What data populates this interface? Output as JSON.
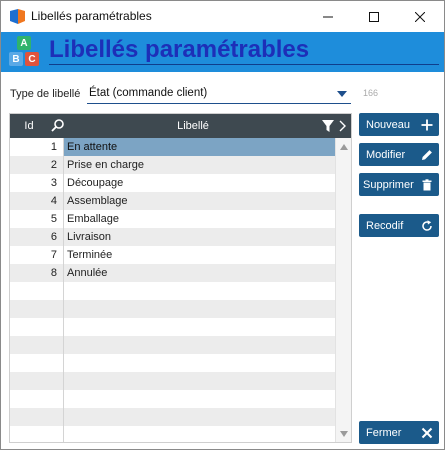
{
  "window": {
    "title": "Libellés paramétrables"
  },
  "banner": {
    "title": "Libellés paramétrables",
    "logo_letters": [
      "A",
      "B",
      "C"
    ]
  },
  "type_field": {
    "label": "Type de libellé",
    "value": "État (commande client)",
    "count": "166"
  },
  "table": {
    "columns": {
      "id": "Id",
      "libelle": "Libellé"
    },
    "rows": [
      {
        "id": "1",
        "libelle": "En attente"
      },
      {
        "id": "2",
        "libelle": "Prise en charge"
      },
      {
        "id": "3",
        "libelle": "Découpage"
      },
      {
        "id": "4",
        "libelle": "Assemblage"
      },
      {
        "id": "5",
        "libelle": "Emballage"
      },
      {
        "id": "6",
        "libelle": "Livraison"
      },
      {
        "id": "7",
        "libelle": "Terminée"
      },
      {
        "id": "8",
        "libelle": "Annulée"
      }
    ],
    "selected_row": 0
  },
  "buttons": {
    "nouveau": "Nouveau",
    "modifier": "Modifier",
    "supprimer": "Supprimer",
    "recodif": "Recodif",
    "fermer": "Fermer"
  },
  "icons": {
    "app": "app-icon",
    "minimize": "minimize-icon",
    "maximize": "maximize-icon",
    "close": "close-icon",
    "search": "search-icon",
    "filter": "filter-icon",
    "more": "chevron-right-icon",
    "plus": "plus-icon",
    "pencil": "pencil-icon",
    "trash": "trash-icon",
    "refresh": "refresh-icon",
    "fermer": "close-x-icon"
  },
  "colors": {
    "banner": "#1e8ddb",
    "banner_title": "#1d2fb8",
    "button": "#1b5a8a",
    "header": "#3e4950",
    "selected": "#7ca4c4"
  }
}
